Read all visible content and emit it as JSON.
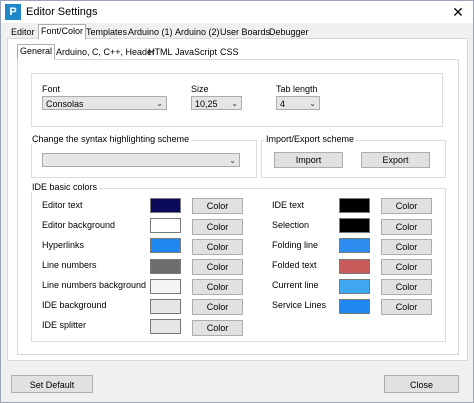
{
  "window": {
    "title": "Editor Settings",
    "icon_letter": "P",
    "close_glyph": "✕"
  },
  "outer_tabs": [
    "Editor",
    "Font/Color",
    "Templates",
    "Arduino (1)",
    "Arduino (2)",
    "User Boards",
    "Debugger"
  ],
  "inner_tabs": [
    "General",
    "Arduino, C, C++, Header",
    "HTML",
    "JavaScript",
    "CSS"
  ],
  "font": {
    "label": "Font",
    "value": "Consolas"
  },
  "size": {
    "label": "Size",
    "value": "10,25"
  },
  "tab_length": {
    "label": "Tab length",
    "value": "4"
  },
  "syntax": {
    "title": "Change the syntax highlighting scheme",
    "value": ""
  },
  "import_export": {
    "title": "Import/Export scheme",
    "import_label": "Import",
    "export_label": "Export"
  },
  "ide_colors": {
    "title": "IDE basic colors",
    "button_label": "Color",
    "left": [
      {
        "label": "Editor text",
        "color": "#0a0a5a"
      },
      {
        "label": "Editor background",
        "color": "#ffffff"
      },
      {
        "label": "Hyperlinks",
        "color": "#1e88f0"
      },
      {
        "label": "Line numbers",
        "color": "#6e6e6e"
      },
      {
        "label": "Line numbers background",
        "color": "#f4f4f4"
      },
      {
        "label": "IDE background",
        "color": "#e6e6e6"
      },
      {
        "label": "IDE splitter",
        "color": "#e6e6e6"
      }
    ],
    "right": [
      {
        "label": "IDE text",
        "color": "#000000"
      },
      {
        "label": "Selection",
        "color": "#000000"
      },
      {
        "label": "Folding line",
        "color": "#2c8cf0"
      },
      {
        "label": "Folded text",
        "color": "#c85a5a"
      },
      {
        "label": "Current line",
        "color": "#40a8f0"
      },
      {
        "label": "Service Lines",
        "color": "#1e88f0"
      }
    ]
  },
  "footer": {
    "set_default": "Set Default",
    "close": "Close"
  }
}
